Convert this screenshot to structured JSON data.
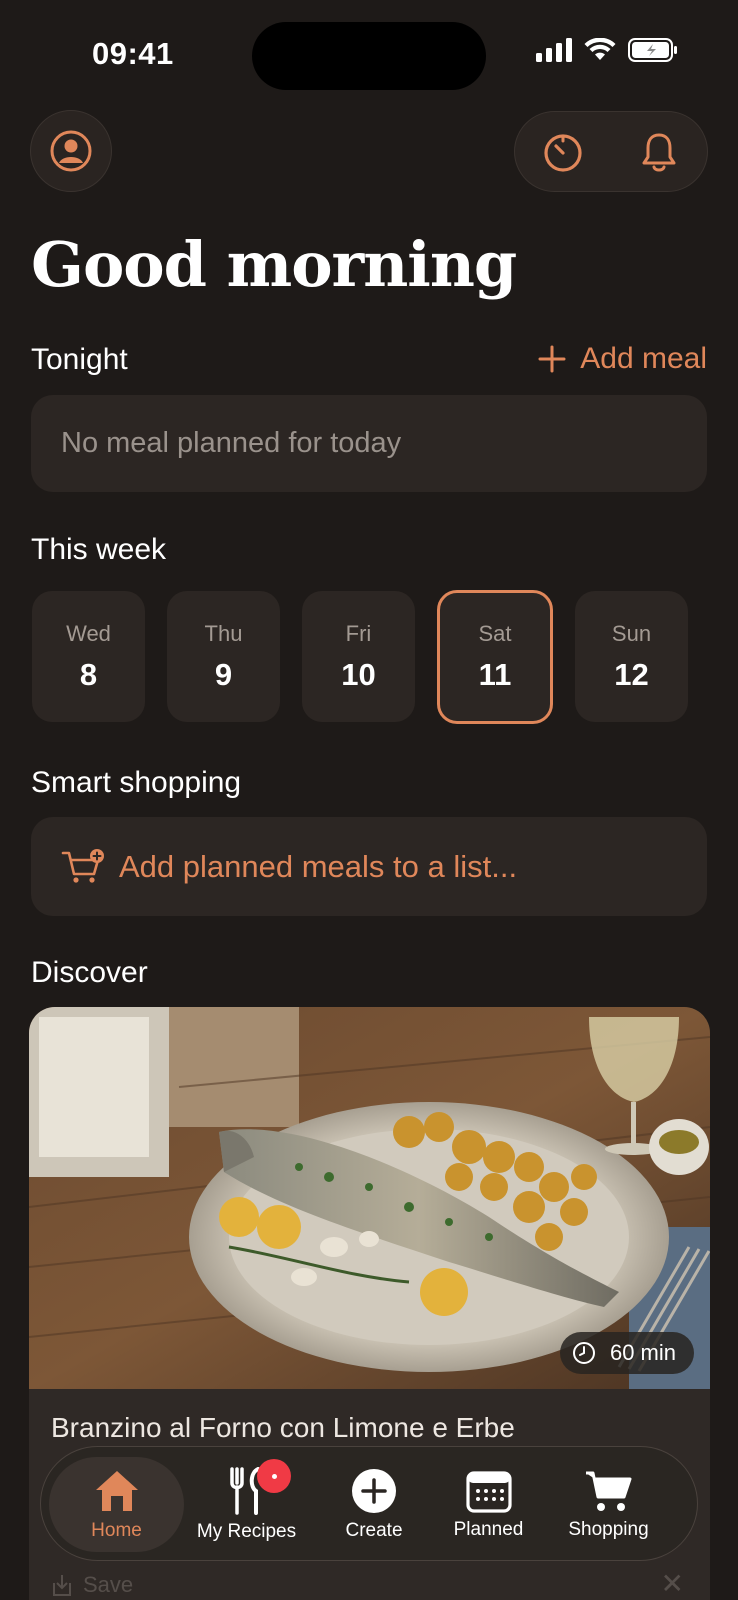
{
  "status": {
    "time": "09:41"
  },
  "header": {
    "greeting": "Good morning"
  },
  "tonight": {
    "title": "Tonight",
    "add_label": "Add meal",
    "empty_text": "No meal planned for today"
  },
  "week": {
    "title": "This week",
    "days": [
      {
        "name": "Wed",
        "num": "8"
      },
      {
        "name": "Thu",
        "num": "9"
      },
      {
        "name": "Fri",
        "num": "10"
      },
      {
        "name": "Sat",
        "num": "11"
      },
      {
        "name": "Sun",
        "num": "12"
      }
    ],
    "selected_index": 3
  },
  "shopping": {
    "title": "Smart shopping",
    "action_text": "Add planned meals to a list..."
  },
  "discover": {
    "title": "Discover",
    "recipe_title": "Branzino al Forno con Limone e Erbe",
    "time_label": "60 min",
    "save_label": "Save"
  },
  "tabs": [
    {
      "label": "Home",
      "icon": "home-icon"
    },
    {
      "label": "My Recipes",
      "icon": "utensils-icon"
    },
    {
      "label": "Create",
      "icon": "plus-circle-icon"
    },
    {
      "label": "Planned",
      "icon": "calendar-icon"
    },
    {
      "label": "Shopping",
      "icon": "cart-icon"
    }
  ],
  "colors": {
    "background": "#1e1a18",
    "card": "#2c2623",
    "accent": "#e0875a",
    "badge": "#f03a45"
  }
}
